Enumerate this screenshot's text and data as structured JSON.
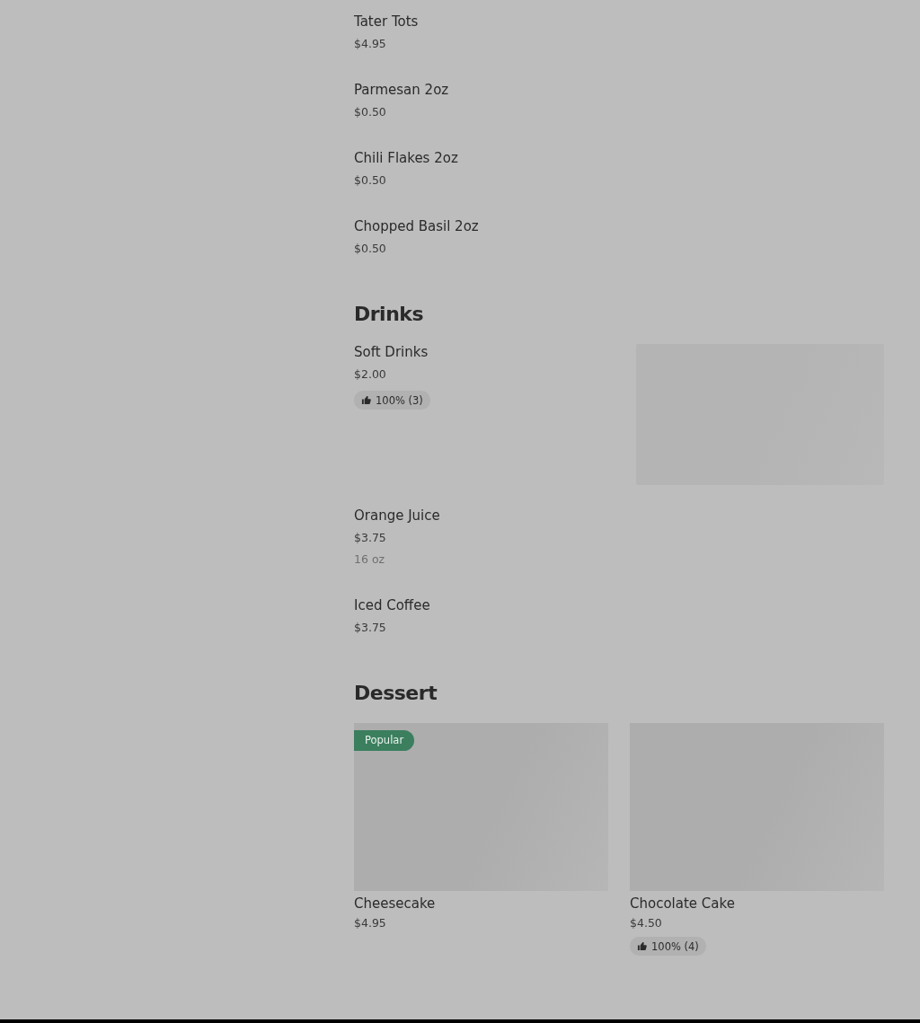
{
  "sections": [
    {
      "items": [
        {
          "kind": "row",
          "name": "Tater Tots",
          "price": "$4.95"
        },
        {
          "kind": "row",
          "name": "Parmesan 2oz",
          "price": "$0.50"
        },
        {
          "kind": "row",
          "name": "Chili Flakes 2oz",
          "price": "$0.50"
        },
        {
          "kind": "row",
          "name": "Chopped Basil 2oz",
          "price": "$0.50"
        }
      ]
    },
    {
      "title": "Drinks",
      "items": [
        {
          "kind": "row",
          "name": "Soft Drinks",
          "price": "$2.00",
          "rating": "100% (3)",
          "image": true
        },
        {
          "kind": "row",
          "name": "Orange Juice",
          "price": "$3.75",
          "note": "16 oz"
        },
        {
          "kind": "row",
          "name": "Iced Coffee",
          "price": "$3.75"
        }
      ]
    },
    {
      "title": "Dessert",
      "items": [
        {
          "kind": "card",
          "name": "Cheesecake",
          "price": "$4.95",
          "badge": "Popular"
        },
        {
          "kind": "card",
          "name": "Chocolate Cake",
          "price": "$4.50",
          "rating": "100% (4)"
        }
      ]
    }
  ]
}
